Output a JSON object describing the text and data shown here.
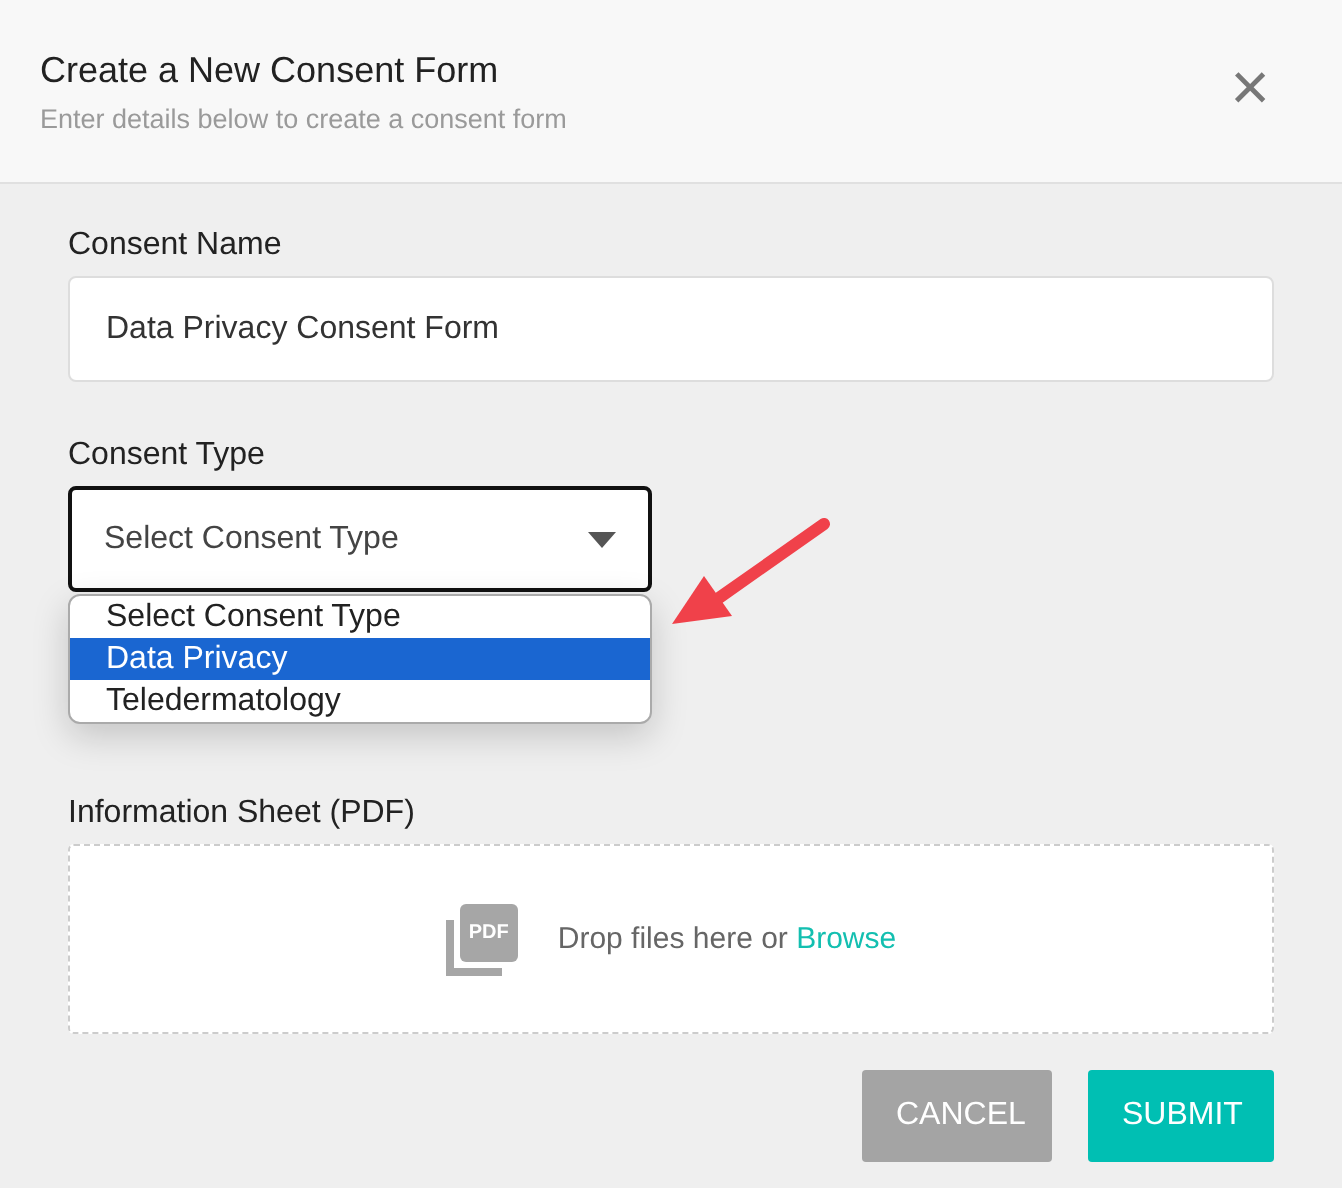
{
  "dialog": {
    "title": "Create a New Consent Form",
    "subtitle": "Enter details below to create a consent form",
    "close": "×"
  },
  "consent_name": {
    "label": "Consent Name",
    "value": "Data Privacy Consent Form"
  },
  "consent_type": {
    "label": "Consent Type",
    "value": "Select Consent Type",
    "expanded": true,
    "options": [
      {
        "label": "Select Consent Type",
        "highlighted": false
      },
      {
        "label": "Data Privacy",
        "highlighted": true
      },
      {
        "label": "Teledermatology",
        "highlighted": false
      }
    ]
  },
  "information_sheet": {
    "label": "Information Sheet (PDF)",
    "icon_text": "PDF",
    "drop_text": "Drop files here or",
    "browse_link": "Browse"
  },
  "buttons": [
    {
      "label": "CANCEL",
      "kind": "secondary"
    },
    {
      "label": "SUBMIT",
      "kind": "primary"
    }
  ]
}
